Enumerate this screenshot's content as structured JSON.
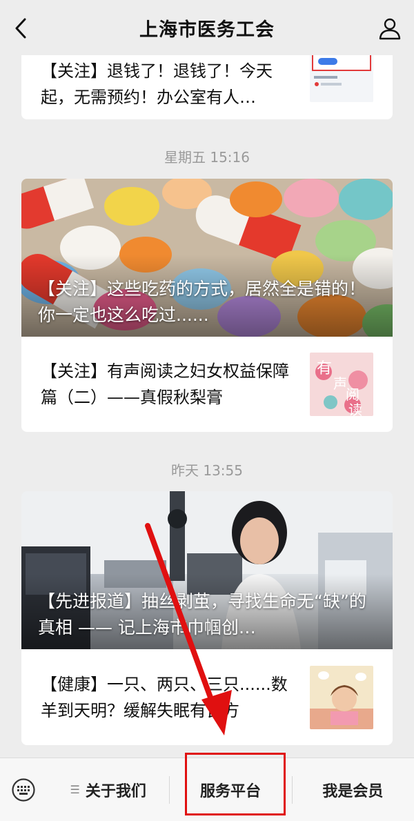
{
  "header": {
    "title": "上海市医务工会",
    "back_icon": "chevron-left-icon",
    "profile_icon": "person-icon"
  },
  "feed": {
    "top_item": {
      "title": "【关注】退钱了！退钱了！今天起，无需预约！办公室有人…"
    },
    "groups": [
      {
        "timestamp": "星期五 15:16",
        "cover_title": "【关注】这些吃药的方式，居然全是错的！你一定也这么吃过......",
        "items": [
          {
            "title": "【关注】有声阅读之妇女权益保障篇（二）——真假秋梨膏",
            "thumb_text": "有声阅读"
          }
        ]
      },
      {
        "timestamp": "昨天 13:55",
        "cover_title": "【先进报道】抽丝剥茧，寻找生命无“缺”的真相 —— 记上海市巾帼创…",
        "items": [
          {
            "title": "【健康】一只、两只、三只......数羊到天明？缓解失眠有良方"
          }
        ]
      }
    ]
  },
  "menu": {
    "keyboard_icon": "keyboard-icon",
    "items": [
      {
        "label": "关于我们",
        "has_submenu": true
      },
      {
        "label": "服务平台"
      },
      {
        "label": "我是会员"
      }
    ]
  },
  "colors": {
    "annotation_red": "#e01010",
    "background": "#ededed"
  }
}
